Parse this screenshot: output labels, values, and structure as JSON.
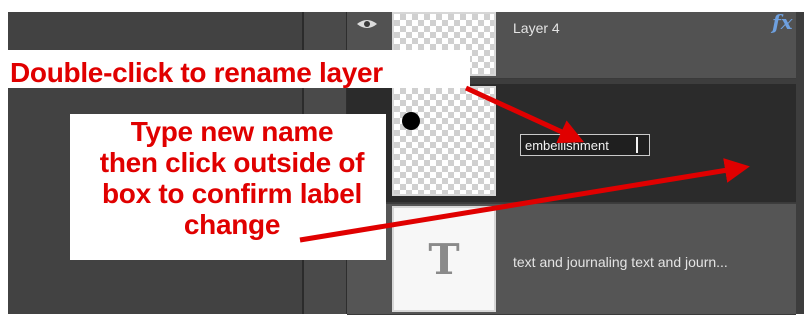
{
  "layers_panel": {
    "layers": [
      {
        "name": "Layer 4",
        "has_fx": true,
        "fx_label": "fx",
        "visible_icon": "eye-icon"
      },
      {
        "name_input_value": "embellishment",
        "selected": true
      },
      {
        "name": "text and journaling text and journ...",
        "thumb_glyph": "T"
      }
    ]
  },
  "annotations": {
    "callout_rename": "Double-click to rename layer",
    "callout_instructions": [
      "Type new name",
      "then click outside of",
      "box to confirm label",
      "change"
    ]
  },
  "colors": {
    "annotation_red": "#e00000",
    "panel_dark": "#2b2b2b",
    "fx_blue": "#6ea0df"
  }
}
